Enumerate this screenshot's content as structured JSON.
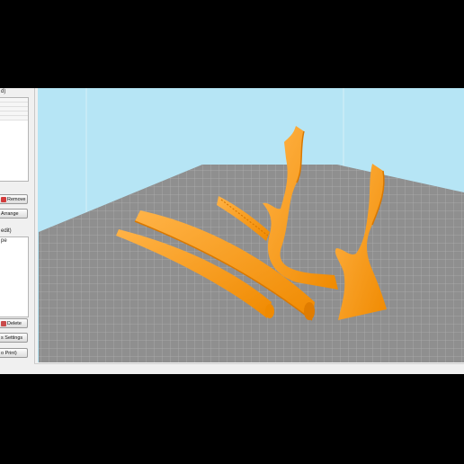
{
  "left_panel": {
    "plater_header": "d)",
    "remove_button": "Remove",
    "arrange_button": "Arrange",
    "object_header": "edit)",
    "object_column": "pe",
    "delete_button": "Delete",
    "settings_button": "s Settings",
    "print_button": "o Print)"
  },
  "colors": {
    "background": "#b6e5f5",
    "bed": "#8f8f8f",
    "model": "#ff9a1a"
  }
}
